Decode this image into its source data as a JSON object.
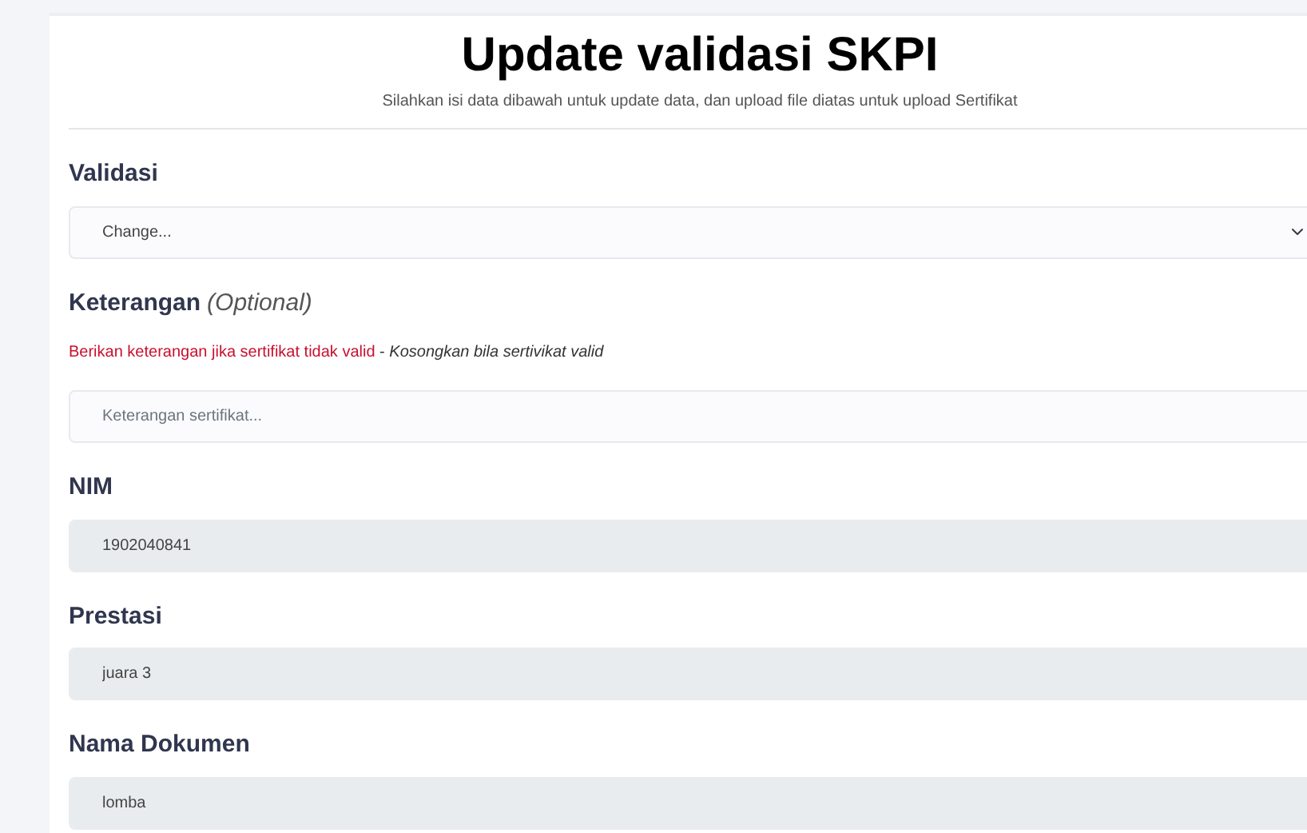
{
  "title": "Update validasi SKPI",
  "subtitle": "Silahkan isi data dibawah untuk update data, dan upload file diatas untuk upload Sertifikat",
  "fields": [
    {
      "kind": "select",
      "label": "Validasi",
      "value": "Change...",
      "disabled": false
    },
    {
      "kind": "text",
      "label": "Keterangan",
      "label_note": "(Optional)",
      "help_warning": "Berikan keterangan jika sertifikat tidak valid",
      "help_separator": "-",
      "help_note": "Kosongkan bila sertivikat valid",
      "placeholder": "Keterangan sertifikat...",
      "disabled": false
    },
    {
      "kind": "text",
      "label": "NIM",
      "value": "1902040841",
      "disabled": true
    },
    {
      "kind": "text",
      "label": "Prestasi",
      "value": "juara 3",
      "disabled": true
    },
    {
      "kind": "text",
      "label": "Nama Dokumen",
      "value": "lomba",
      "disabled": true
    }
  ]
}
